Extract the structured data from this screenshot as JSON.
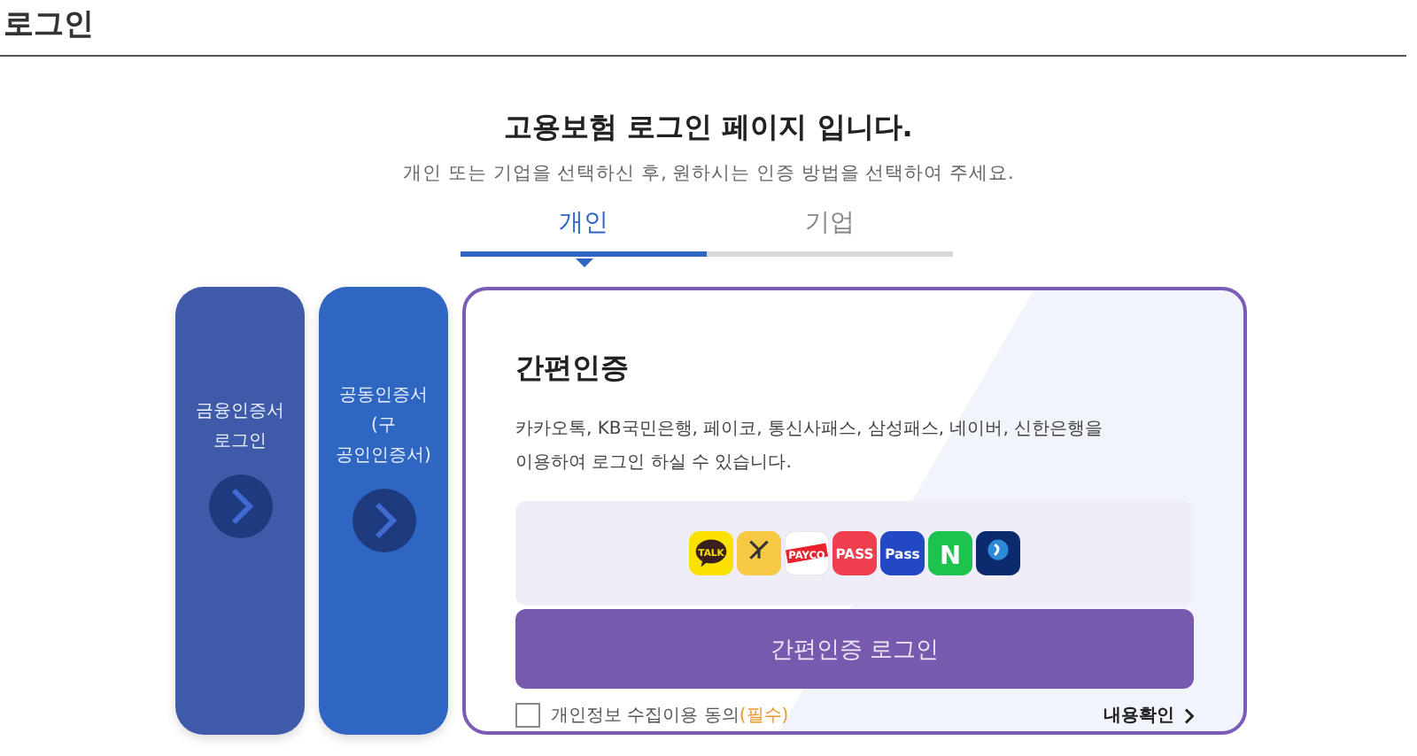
{
  "page_title": "로그인",
  "heading": "고용보험 로그인 페이지 입니다.",
  "subheading": "개인 또는 기업을 선택하신 후, 원하시는 인증 방법을 선택하여 주세요.",
  "tabs": [
    {
      "label": "개인",
      "selected": true
    },
    {
      "label": "기업",
      "selected": false
    }
  ],
  "side_cards": [
    {
      "label": "금융인증서\n로그인",
      "color": "#3f5aa8"
    },
    {
      "label": "공동인증서\n(구\n공인인증서)",
      "color": "#2e66c2"
    }
  ],
  "main_card": {
    "title": "간편인증",
    "description": "카카오톡, KB국민은행, 페이코, 통신사패스, 삼성패스, 네이버, 신한은행을 이용하여 로그인 하실 수 있습니다.",
    "providers": [
      {
        "kind": "kakao",
        "label": "TALK"
      },
      {
        "kind": "kb"
      },
      {
        "kind": "payco",
        "label": "PAYCO"
      },
      {
        "kind": "pass",
        "label": "PASS"
      },
      {
        "kind": "samsung",
        "label": "Pass"
      },
      {
        "kind": "naver",
        "label": "N"
      },
      {
        "kind": "shinhan"
      }
    ],
    "login_button": "간편인증 로그인",
    "consent": {
      "label": "개인정보 수집이용 동의",
      "required": "(필수)",
      "checked": false
    },
    "details_link": "내용확인"
  }
}
